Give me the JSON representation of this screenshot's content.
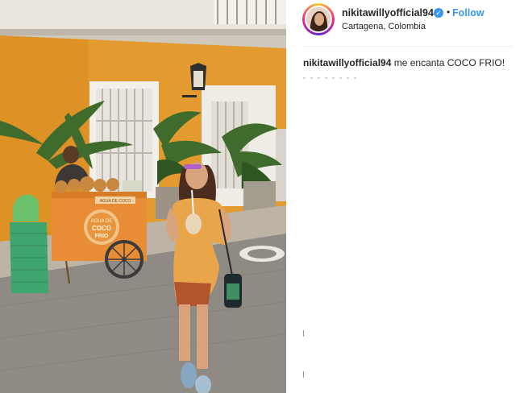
{
  "post": {
    "image_alt": "",
    "username": "nikitawillyofficial94",
    "follow_label": "Follow",
    "dot": "•",
    "verified_glyph": "✓",
    "location": "Cartagena, Colombia",
    "caption": {
      "username": "nikitawillyofficial94",
      "text": "me encanta COCO FRIO!"
    }
  },
  "cart": {
    "sign_top": "AGUA DE COCO",
    "sign_circle_line1": "AGUA DE",
    "sign_circle_line2": "COCO",
    "sign_circle_line3": "FRIO"
  },
  "colors": {
    "follow": "#3897f0",
    "wall": "#e39a2e",
    "dress": "#e9a54a"
  },
  "icons": {
    "verified": "verified-badge-icon"
  }
}
